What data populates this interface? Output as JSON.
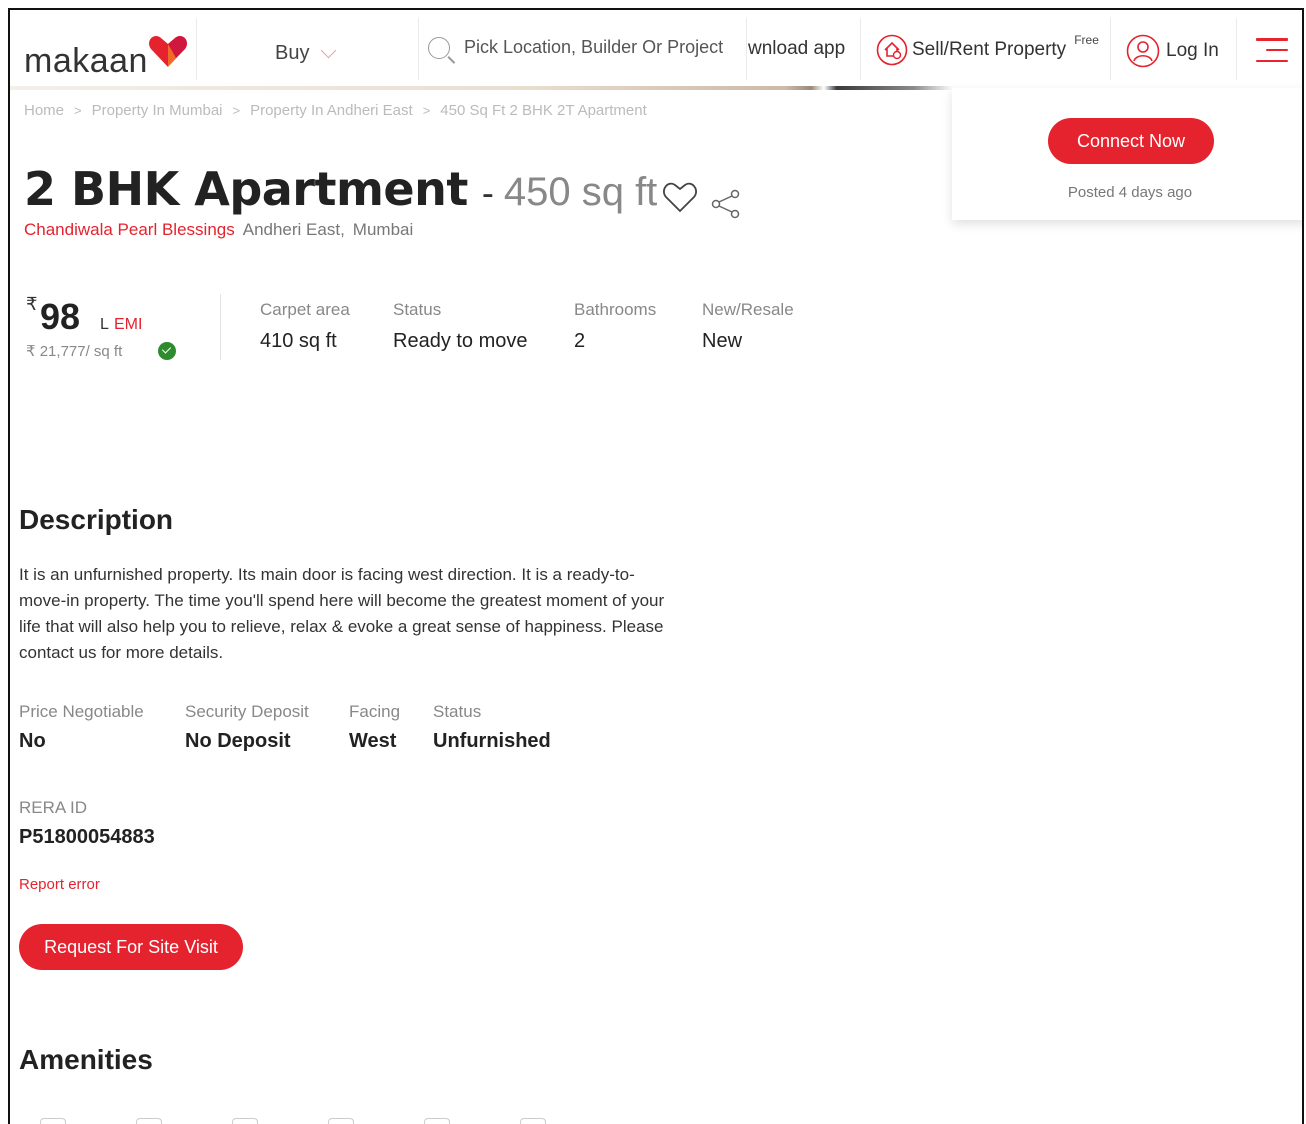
{
  "header": {
    "logo_text": "makaan",
    "buy_label": "Buy",
    "search_placeholder": "Pick Location, Builder Or Project",
    "download_label": "wnload app",
    "sell_label": "Sell/Rent Property",
    "sell_badge": "Free",
    "login_label": "Log In"
  },
  "breadcrumb": {
    "items": [
      "Home",
      "Property In Mumbai",
      "Property In Andheri East",
      "450 Sq Ft 2 BHK 2T Apartment"
    ],
    "separator": ">"
  },
  "connect": {
    "button_label": "Connect Now",
    "posted": "Posted 4 days ago"
  },
  "listing": {
    "title": "2 BHK Apartment",
    "dash": "-",
    "area": "450 sq ft",
    "project": "Chandiwala Pearl Blessings",
    "locality": "Andheri East,",
    "city": "Mumbai"
  },
  "price": {
    "currency": "₹",
    "amount": "98",
    "unit": "L",
    "emi_label": "EMI",
    "per_sqft": "₹ 21,777/ sq ft"
  },
  "key_facts": [
    {
      "label": "Carpet area",
      "value": "410 sq ft"
    },
    {
      "label": "Status",
      "value": "Ready to move"
    },
    {
      "label": "Bathrooms",
      "value": "2"
    },
    {
      "label": "New/Resale",
      "value": "New"
    }
  ],
  "description": {
    "heading": "Description",
    "text": "It is an unfurnished property. Its main door is facing west direction. It is a ready-to-move-in property. The time you'll spend here will become the greatest moment of your life that will also help you to relieve, relax & evoke a great sense of happiness. Please contact us for more details."
  },
  "details": [
    {
      "label": "Price Negotiable",
      "value": "No"
    },
    {
      "label": "Security Deposit",
      "value": "No Deposit"
    },
    {
      "label": "Facing",
      "value": "West"
    },
    {
      "label": "Status",
      "value": "Unfurnished"
    }
  ],
  "rera": {
    "label": "RERA ID",
    "value": "P51800054883"
  },
  "report_label": "Report error",
  "site_visit_label": "Request For Site Visit",
  "amenities_heading": "Amenities",
  "colors": {
    "brand_red": "#e4232e",
    "muted": "#888888",
    "text": "#222222"
  }
}
